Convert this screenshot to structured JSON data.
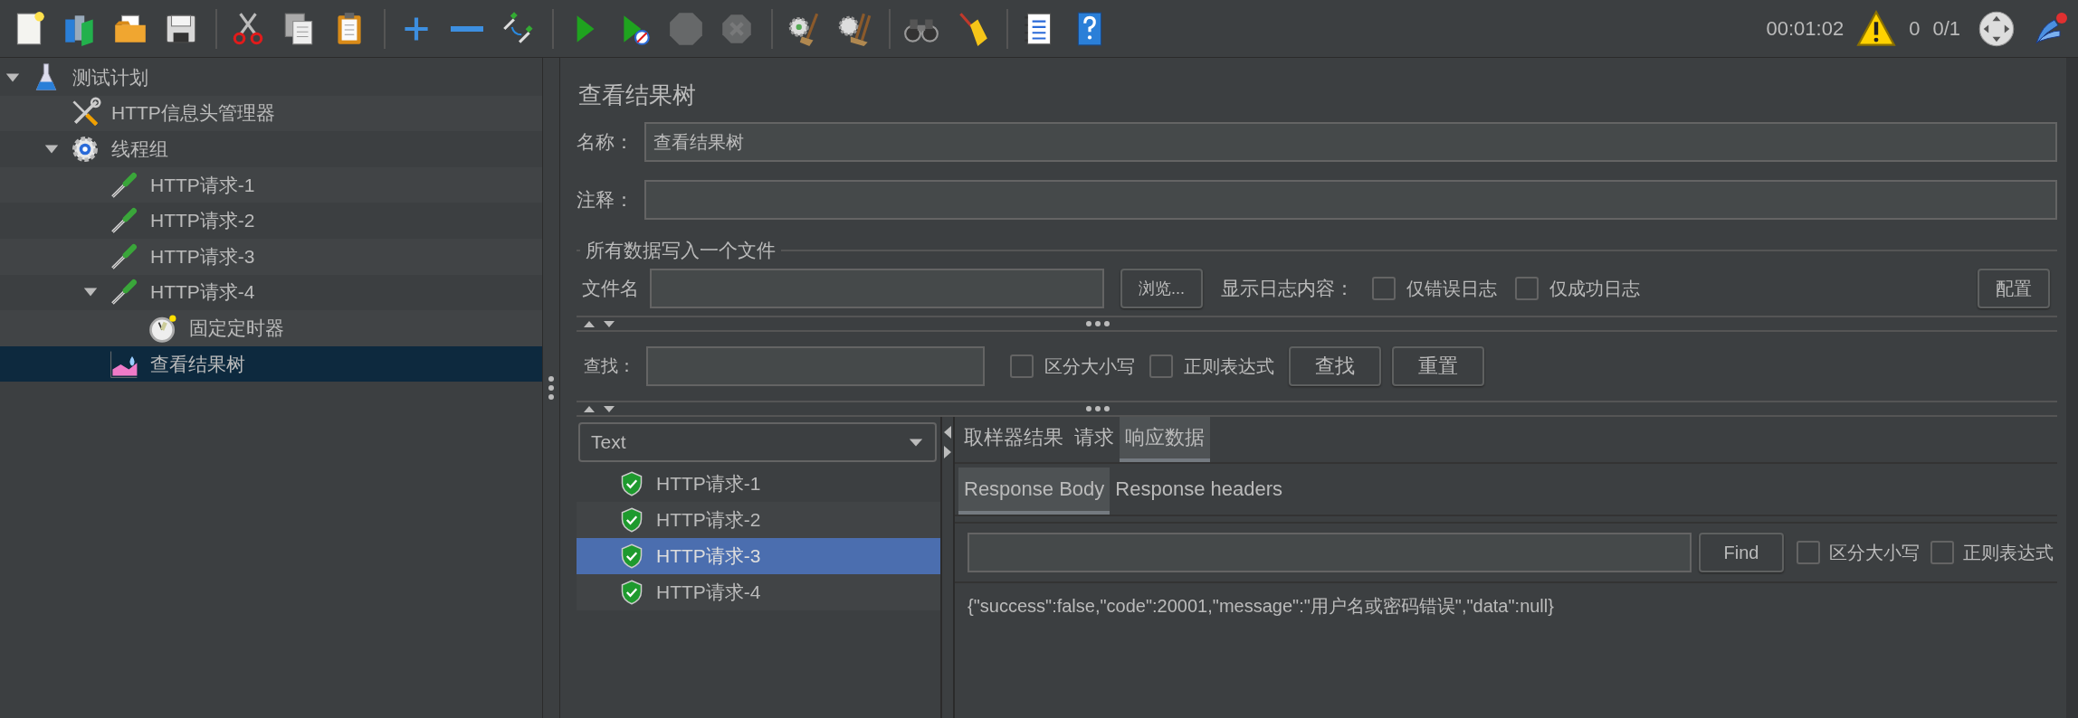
{
  "toolbar": [
    {
      "kind": "new",
      "disabled": false
    },
    {
      "kind": "templates",
      "disabled": false
    },
    {
      "kind": "open",
      "disabled": false
    },
    {
      "kind": "save",
      "disabled": false
    },
    {
      "kind": "separator"
    },
    {
      "kind": "cut",
      "disabled": false
    },
    {
      "kind": "copy",
      "disabled": false
    },
    {
      "kind": "paste",
      "disabled": false
    },
    {
      "kind": "separator"
    },
    {
      "kind": "expand",
      "disabled": false
    },
    {
      "kind": "collapse",
      "disabled": false
    },
    {
      "kind": "toggle",
      "disabled": false
    },
    {
      "kind": "separator"
    },
    {
      "kind": "start",
      "disabled": false
    },
    {
      "kind": "start-no-pause",
      "disabled": false
    },
    {
      "kind": "stop",
      "disabled": true
    },
    {
      "kind": "shutdown",
      "disabled": true
    },
    {
      "kind": "separator"
    },
    {
      "kind": "clear",
      "disabled": false
    },
    {
      "kind": "clear-all",
      "disabled": false
    },
    {
      "kind": "separator"
    },
    {
      "kind": "search",
      "disabled": false
    },
    {
      "kind": "reset-search",
      "disabled": false
    },
    {
      "kind": "separator"
    },
    {
      "kind": "functions",
      "disabled": false
    },
    {
      "kind": "help",
      "disabled": false
    }
  ],
  "status": {
    "elapsed": "00:01:02",
    "warnings": "0",
    "threads": "0/1"
  },
  "tree": [
    {
      "label": "测试计划",
      "kind": "plan",
      "expanded": true,
      "selected": false,
      "children": [
        {
          "label": "HTTP信息头管理器",
          "kind": "config",
          "selected": false
        },
        {
          "label": "线程组",
          "kind": "thread-group",
          "expanded": true,
          "selected": false,
          "children": [
            {
              "label": "HTTP请求-1",
              "kind": "sampler",
              "selected": false
            },
            {
              "label": "HTTP请求-2",
              "kind": "sampler",
              "selected": false
            },
            {
              "label": "HTTP请求-3",
              "kind": "sampler",
              "selected": false
            },
            {
              "label": "HTTP请求-4",
              "kind": "sampler",
              "expanded": true,
              "selected": false,
              "children": [
                {
                  "label": "固定定时器",
                  "kind": "timer",
                  "selected": false
                }
              ]
            },
            {
              "label": "查看结果树",
              "kind": "listener",
              "selected": true
            }
          ]
        }
      ]
    }
  ],
  "editor": {
    "title": "查看结果树",
    "name": {
      "label": "名称：",
      "value": "查看结果树"
    },
    "comment": {
      "label": "注释："
    },
    "file_group": {
      "title": "所有数据写入一个文件",
      "filename_label": "文件名",
      "browse_button": "浏览...",
      "log_label": "显示日志内容：",
      "checks": [
        {
          "label": "仅错误日志",
          "checked": false
        },
        {
          "label": "仅成功日志",
          "checked": false
        }
      ],
      "config_button": "配置"
    },
    "search": {
      "label": "查找：",
      "checks": [
        {
          "label": "区分大小写",
          "checked": false
        },
        {
          "label": "正则表达式",
          "checked": false
        }
      ],
      "buttons": [
        "查找",
        "重置"
      ]
    }
  },
  "results": {
    "renderer": "Text",
    "items": [
      {
        "label": "HTTP请求-1",
        "kind": "success",
        "selected": false
      },
      {
        "label": "HTTP请求-2",
        "kind": "success",
        "selected": false
      },
      {
        "label": "HTTP请求-3",
        "kind": "success",
        "selected": true
      },
      {
        "label": "HTTP请求-4",
        "kind": "success",
        "selected": false
      }
    ]
  },
  "tabs": [
    {
      "label": "取样器结果",
      "selected": false
    },
    {
      "label": "请求",
      "selected": false
    },
    {
      "label": "响应数据",
      "selected": true
    }
  ],
  "sub_tabs": [
    {
      "label": "Response Body",
      "selected": true
    },
    {
      "label": "Response headers",
      "selected": false
    }
  ],
  "response_search": {
    "button": "Find",
    "checks": [
      {
        "label": "区分大小写",
        "checked": false
      },
      {
        "label": "正则表达式",
        "checked": false
      }
    ]
  },
  "response_body": "{\"success\":false,\"code\":20001,\"message\":\"用户名或密码错误\",\"data\":null}"
}
